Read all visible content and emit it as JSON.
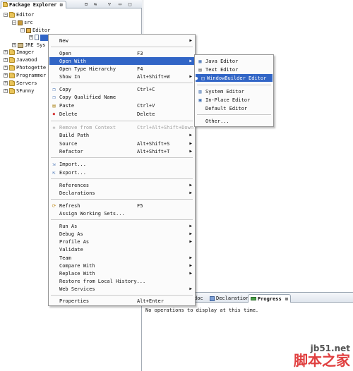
{
  "package_explorer": {
    "tab_label": "Package Explorer",
    "close_glyph": "⊠",
    "tree": [
      {
        "label": "Editor"
      },
      {
        "label": "src"
      },
      {
        "label": "Editor"
      },
      {
        "label": ""
      },
      {
        "label": "JRE Sys"
      },
      {
        "label": "Imager"
      },
      {
        "label": "JavaGod"
      },
      {
        "label": "Photogette"
      },
      {
        "label": "Programmer"
      },
      {
        "label": "Servers"
      },
      {
        "label": "SFunny"
      }
    ]
  },
  "context_menu": {
    "items": [
      {
        "label": "New",
        "accel": ""
      },
      {
        "label": "Open",
        "accel": "F3"
      },
      {
        "label": "Open With",
        "accel": ""
      },
      {
        "label": "Open Type Hierarchy",
        "accel": "F4"
      },
      {
        "label": "Show In",
        "accel": "Alt+Shift+W"
      },
      {
        "label": "Copy",
        "accel": "Ctrl+C"
      },
      {
        "label": "Copy Qualified Name",
        "accel": ""
      },
      {
        "label": "Paste",
        "accel": "Ctrl+V"
      },
      {
        "label": "Delete",
        "accel": "Delete"
      },
      {
        "label": "Remove from Context",
        "accel": "Ctrl+Alt+Shift+Down"
      },
      {
        "label": "Build Path",
        "accel": ""
      },
      {
        "label": "Source",
        "accel": "Alt+Shift+S"
      },
      {
        "label": "Refactor",
        "accel": "Alt+Shift+T"
      },
      {
        "label": "Import...",
        "accel": ""
      },
      {
        "label": "Export...",
        "accel": ""
      },
      {
        "label": "References",
        "accel": ""
      },
      {
        "label": "Declarations",
        "accel": ""
      },
      {
        "label": "Refresh",
        "accel": "F5"
      },
      {
        "label": "Assign Working Sets...",
        "accel": ""
      },
      {
        "label": "Run As",
        "accel": ""
      },
      {
        "label": "Debug As",
        "accel": ""
      },
      {
        "label": "Profile As",
        "accel": ""
      },
      {
        "label": "Validate",
        "accel": ""
      },
      {
        "label": "Team",
        "accel": ""
      },
      {
        "label": "Compare With",
        "accel": ""
      },
      {
        "label": "Replace With",
        "accel": ""
      },
      {
        "label": "Restore from Local History...",
        "accel": ""
      },
      {
        "label": "Web Services",
        "accel": ""
      },
      {
        "label": "Properties",
        "accel": "Alt+Enter"
      }
    ]
  },
  "submenu": {
    "items": [
      {
        "label": "Java Editor"
      },
      {
        "label": "Text Editor"
      },
      {
        "label": "WindowBuilder Editor"
      },
      {
        "label": "System Editor"
      },
      {
        "label": "In-Place Editor"
      },
      {
        "label": "Default Editor"
      },
      {
        "label": "Other..."
      }
    ]
  },
  "bottom_panel": {
    "tabs": [
      "doc",
      "Declaration",
      "Progress"
    ],
    "close_glyph": "⊠",
    "message": "No operations to display at this time."
  },
  "watermark": {
    "url": "jb51.net",
    "chinese": "脚本之家"
  },
  "colors": {
    "highlight": "#3165c6",
    "menu_bg": "#fbfbfb",
    "disabled": "#a0a0a0"
  }
}
